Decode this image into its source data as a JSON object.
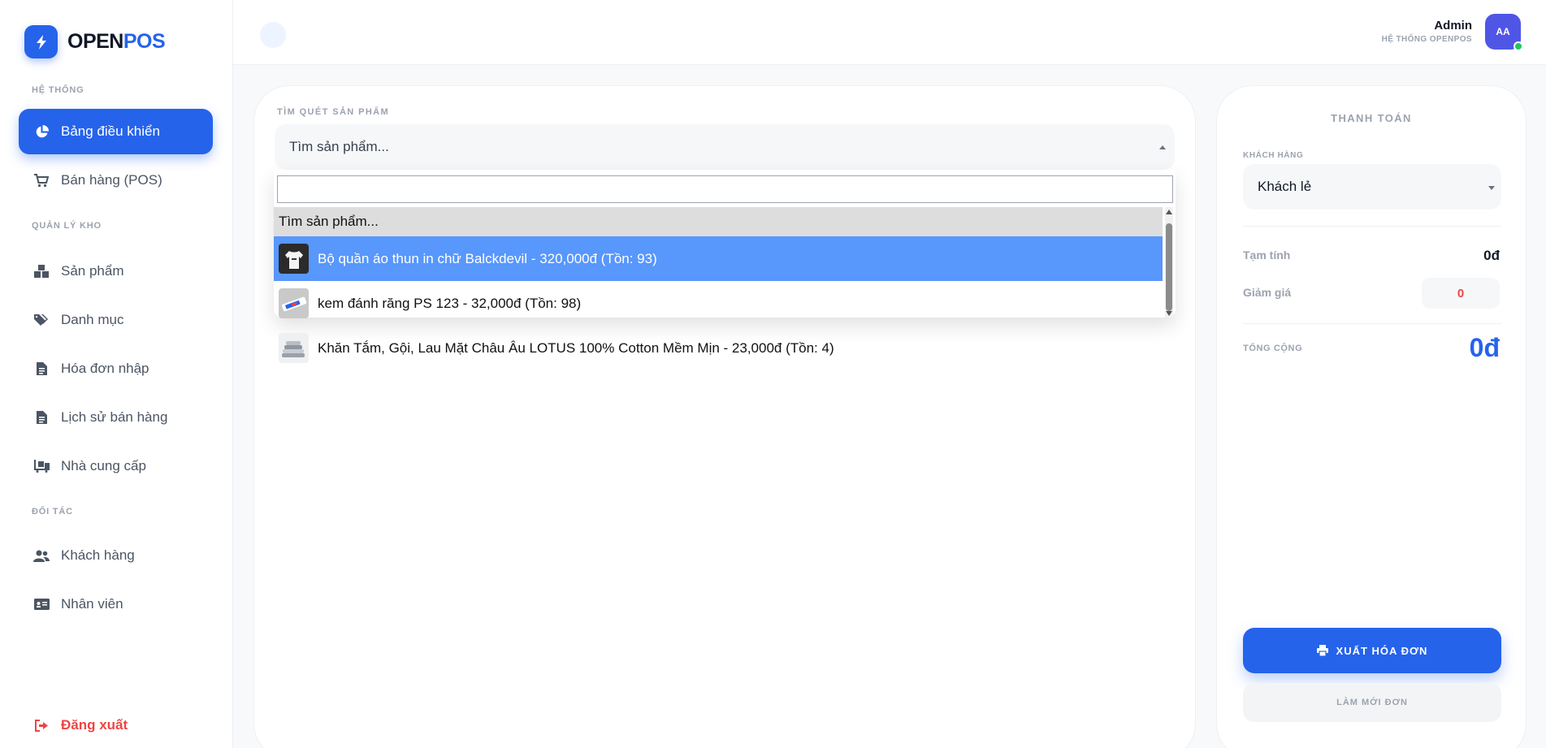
{
  "brand": {
    "name_part1": "OPEN",
    "name_part2": "POS",
    "accent": "#2563eb"
  },
  "sidebar": {
    "sections": [
      {
        "label": "HỆ THỐNG"
      },
      {
        "label": "QUẢN LÝ KHO"
      },
      {
        "label": "ĐỐI TÁC"
      }
    ],
    "items": [
      {
        "label": "Bảng điều khiển",
        "icon": "pie-chart-icon",
        "active": true
      },
      {
        "label": "Bán hàng (POS)",
        "icon": "cart-icon"
      },
      {
        "label": "Sản phẩm",
        "icon": "boxes-icon"
      },
      {
        "label": "Danh mục",
        "icon": "tags-icon"
      },
      {
        "label": "Hóa đơn nhập",
        "icon": "invoice-icon"
      },
      {
        "label": "Lịch sử bán hàng",
        "icon": "invoice-icon"
      },
      {
        "label": "Nhà cung cấp",
        "icon": "truck-loading-icon"
      },
      {
        "label": "Khách hàng",
        "icon": "users-icon"
      },
      {
        "label": "Nhân viên",
        "icon": "id-card-icon"
      }
    ],
    "logout": {
      "label": "Đăng xuất",
      "icon": "sign-out-icon"
    }
  },
  "header": {
    "user_name": "Admin",
    "user_subtitle": "HỆ THỐNG OPENPOS",
    "avatar_initials": "AA"
  },
  "search": {
    "label": "TÌM QUÉT SẢN PHẨM",
    "selected_text": "Tìm sản phẩm...",
    "search_value": "",
    "options": [
      {
        "text": "Tìm sản phẩm...",
        "placeholder": true
      },
      {
        "text": "Bộ quần áo thun in chữ Balckdevil - 320,000đ (Tồn: 93)",
        "thumb": "tshirt-thumbnail"
      },
      {
        "text": "kem đánh răng PS 123 - 32,000đ (Tồn: 98)",
        "thumb": "toothpaste-thumbnail"
      },
      {
        "text": "Khăn Tắm, Gội, Lau Mặt Châu Âu LOTUS 100% Cotton Mềm Mịn - 23,000đ (Tồn: 4)",
        "thumb": "towel-thumbnail"
      }
    ]
  },
  "checkout": {
    "title": "THANH TOÁN",
    "customer_label": "KHÁCH HÀNG",
    "customer_value": "Khách lẻ",
    "subtotal_label": "Tạm tính",
    "subtotal_value": "0đ",
    "discount_label": "Giảm giá",
    "discount_value": "0",
    "total_label": "TỔNG CỘNG",
    "total_value": "0đ",
    "checkout_button": "XUẤT HÓA ĐƠN",
    "reset_button": "LÀM MỚI ĐƠN"
  }
}
